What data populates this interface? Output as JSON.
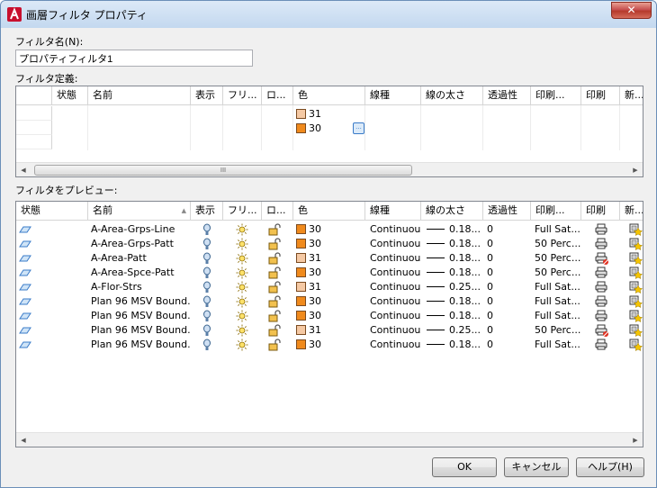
{
  "window": {
    "title": "画層フィルタ プロパティ",
    "close": "✕"
  },
  "filter_name": {
    "label": "フィルタ名(N):",
    "value": "プロパティフィルタ1"
  },
  "definition": {
    "label": "フィルタ定義:",
    "columns": [
      "状態",
      "名前",
      "表示",
      "フリ...",
      "ロ...",
      "色",
      "線種",
      "線の太さ",
      "透過性",
      "印刷...",
      "印刷",
      "新..."
    ],
    "rows": [
      {
        "color": "31",
        "swatch": "#f5c9a4"
      },
      {
        "color": "30",
        "swatch": "#f08a1c"
      }
    ],
    "color_picker_button": "..."
  },
  "preview": {
    "label": "フィルタをプレビュー:",
    "columns": [
      "状態",
      "名前",
      "表示",
      "フリ...",
      "ロ...",
      "色",
      "線種",
      "線の太さ",
      "透過性",
      "印刷...",
      "印刷",
      "新..."
    ],
    "rows": [
      {
        "name": "A-Area-Grps-Line",
        "color": "30",
        "swatch": "#f08a1c",
        "linetype": "Continuous",
        "lineweight": "0.18...",
        "transparency": "0",
        "plotstyle": "Full Sat...",
        "plot_disabled": false
      },
      {
        "name": "A-Area-Grps-Patt",
        "color": "30",
        "swatch": "#f08a1c",
        "linetype": "Continuous",
        "lineweight": "0.18...",
        "transparency": "0",
        "plotstyle": "50 Perc...",
        "plot_disabled": false
      },
      {
        "name": "A-Area-Patt",
        "color": "31",
        "swatch": "#f5c9a4",
        "linetype": "Continuous",
        "lineweight": "0.18...",
        "transparency": "0",
        "plotstyle": "50 Perc...",
        "plot_disabled": true
      },
      {
        "name": "A-Area-Spce-Patt",
        "color": "30",
        "swatch": "#f08a1c",
        "linetype": "Continuous",
        "lineweight": "0.18...",
        "transparency": "0",
        "plotstyle": "50 Perc...",
        "plot_disabled": false
      },
      {
        "name": "A-Flor-Strs",
        "color": "31",
        "swatch": "#f5c9a4",
        "linetype": "Continuous",
        "lineweight": "0.25...",
        "transparency": "0",
        "plotstyle": "Full Sat...",
        "plot_disabled": false
      },
      {
        "name": "Plan 96 MSV Bound...",
        "color": "30",
        "swatch": "#f08a1c",
        "linetype": "Continuous",
        "lineweight": "0.18...",
        "transparency": "0",
        "plotstyle": "Full Sat...",
        "plot_disabled": false
      },
      {
        "name": "Plan 96 MSV Bound...",
        "color": "30",
        "swatch": "#f08a1c",
        "linetype": "Continuous",
        "lineweight": "0.18...",
        "transparency": "0",
        "plotstyle": "Full Sat...",
        "plot_disabled": false
      },
      {
        "name": "Plan 96 MSV Bound...",
        "color": "31",
        "swatch": "#f5c9a4",
        "linetype": "Continuous",
        "lineweight": "0.25...",
        "transparency": "0",
        "plotstyle": "50 Perc...",
        "plot_disabled": true
      },
      {
        "name": "Plan 96 MSV Bound...",
        "color": "30",
        "swatch": "#f08a1c",
        "linetype": "Continuous",
        "lineweight": "0.18...",
        "transparency": "0",
        "plotstyle": "Full Sat...",
        "plot_disabled": false
      }
    ]
  },
  "scroll": {
    "thumb_grip": "III"
  },
  "buttons": {
    "ok": "OK",
    "cancel": "キャンセル",
    "help": "ヘルプ(H)"
  },
  "icons": {
    "layer_state": "layer-status-icon",
    "on": "lightbulb-on-icon",
    "thaw": "sun-icon",
    "unlock": "padlock-open-icon",
    "plot": "printer-icon",
    "noplot": "printer-disabled-icon",
    "new_vp": "new-viewport-icon"
  }
}
